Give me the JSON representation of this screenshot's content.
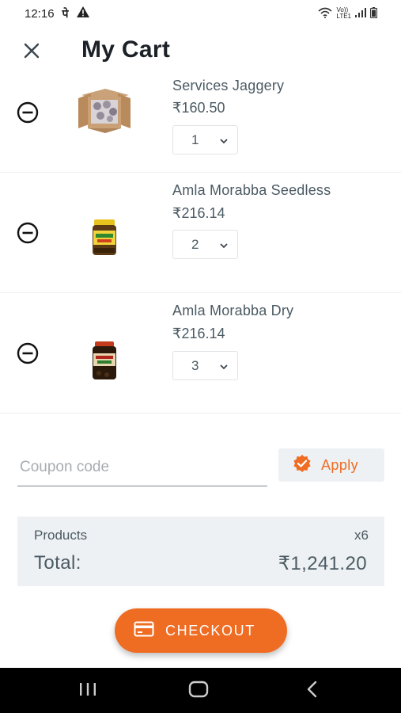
{
  "status_bar": {
    "time": "12:16",
    "left_icons": [
      "devanagari-pe-icon",
      "warning-icon"
    ],
    "network_label_top": "Vo))",
    "network_label_bottom": "LTE1",
    "right_icons": [
      "wifi-icon",
      "signal-icon",
      "battery-icon"
    ]
  },
  "header": {
    "title": "My Cart",
    "close_icon": "close-icon"
  },
  "cart": {
    "items": [
      {
        "name": "Services Jaggery",
        "price": "₹160.50",
        "quantity": "1",
        "image": "cardboard-box-of-jaggery"
      },
      {
        "name": "Amla Morabba Seedless",
        "price": "₹216.14",
        "quantity": "2",
        "image": "amla-jar-yellow-lid"
      },
      {
        "name": "Amla Morabba Dry",
        "price": "₹216.14",
        "quantity": "3",
        "image": "amla-jar-dark"
      }
    ]
  },
  "coupon": {
    "placeholder": "Coupon code",
    "value": "",
    "apply_label": "Apply",
    "apply_icon": "verified-badge-icon"
  },
  "summary": {
    "products_label": "Products",
    "products_count": "x6",
    "total_label": "Total:",
    "total_value": "₹1,241.20"
  },
  "checkout": {
    "label": "CHECKOUT",
    "icon": "credit-card-icon"
  },
  "nav_bar": {
    "buttons": [
      "recents-icon",
      "home-icon",
      "back-icon"
    ]
  },
  "colors": {
    "accent": "#ef6c23",
    "text": "#4b5a63",
    "title": "#1c2127",
    "panel_bg": "#eef1f3",
    "nav_bg": "#000000"
  }
}
